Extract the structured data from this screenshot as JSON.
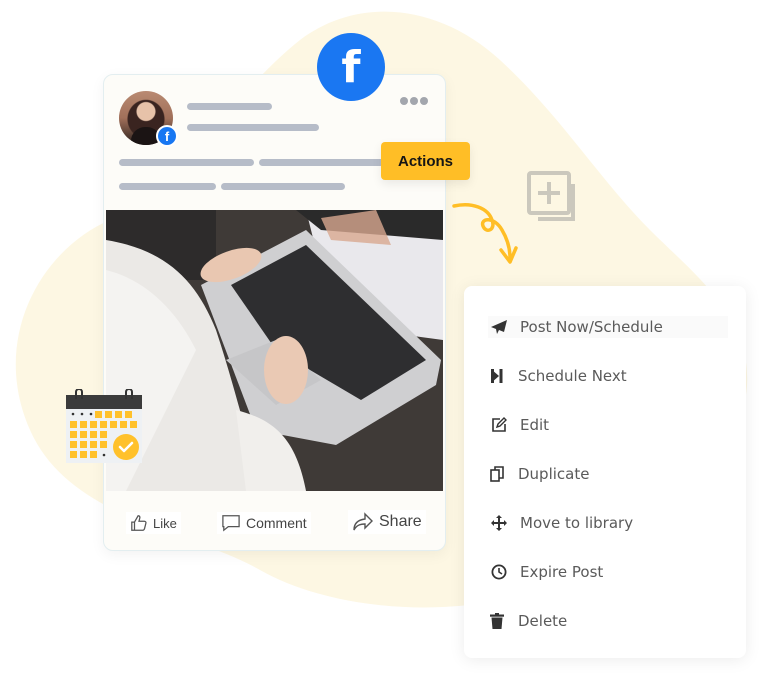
{
  "colors": {
    "blob": "#fdf7e3",
    "facebook_blue": "#1877f2",
    "accent_yellow": "#ffbe26",
    "skeleton_gray": "#b6bcc8"
  },
  "social_network": {
    "name": "Facebook",
    "glyph": "f"
  },
  "post": {
    "avatar_badge_glyph": "f",
    "more_icon": "more-dots-icon",
    "actions": [
      {
        "label": "Like",
        "icon": "thumbs-up-icon"
      },
      {
        "label": "Comment",
        "icon": "comment-icon"
      },
      {
        "label": "Share",
        "icon": "share-icon"
      }
    ]
  },
  "actions_badge": {
    "label": "Actions"
  },
  "menu": {
    "items": [
      {
        "label": "Post Now/Schedule",
        "icon": "paper-plane-icon",
        "active": true
      },
      {
        "label": "Schedule Next",
        "icon": "skip-next-icon"
      },
      {
        "label": "Edit",
        "icon": "edit-icon"
      },
      {
        "label": "Duplicate",
        "icon": "duplicate-icon"
      },
      {
        "label": "Move to library",
        "icon": "move-icon"
      },
      {
        "label": "Expire Post",
        "icon": "clock-icon"
      },
      {
        "label": "Delete",
        "icon": "trash-icon"
      }
    ]
  }
}
